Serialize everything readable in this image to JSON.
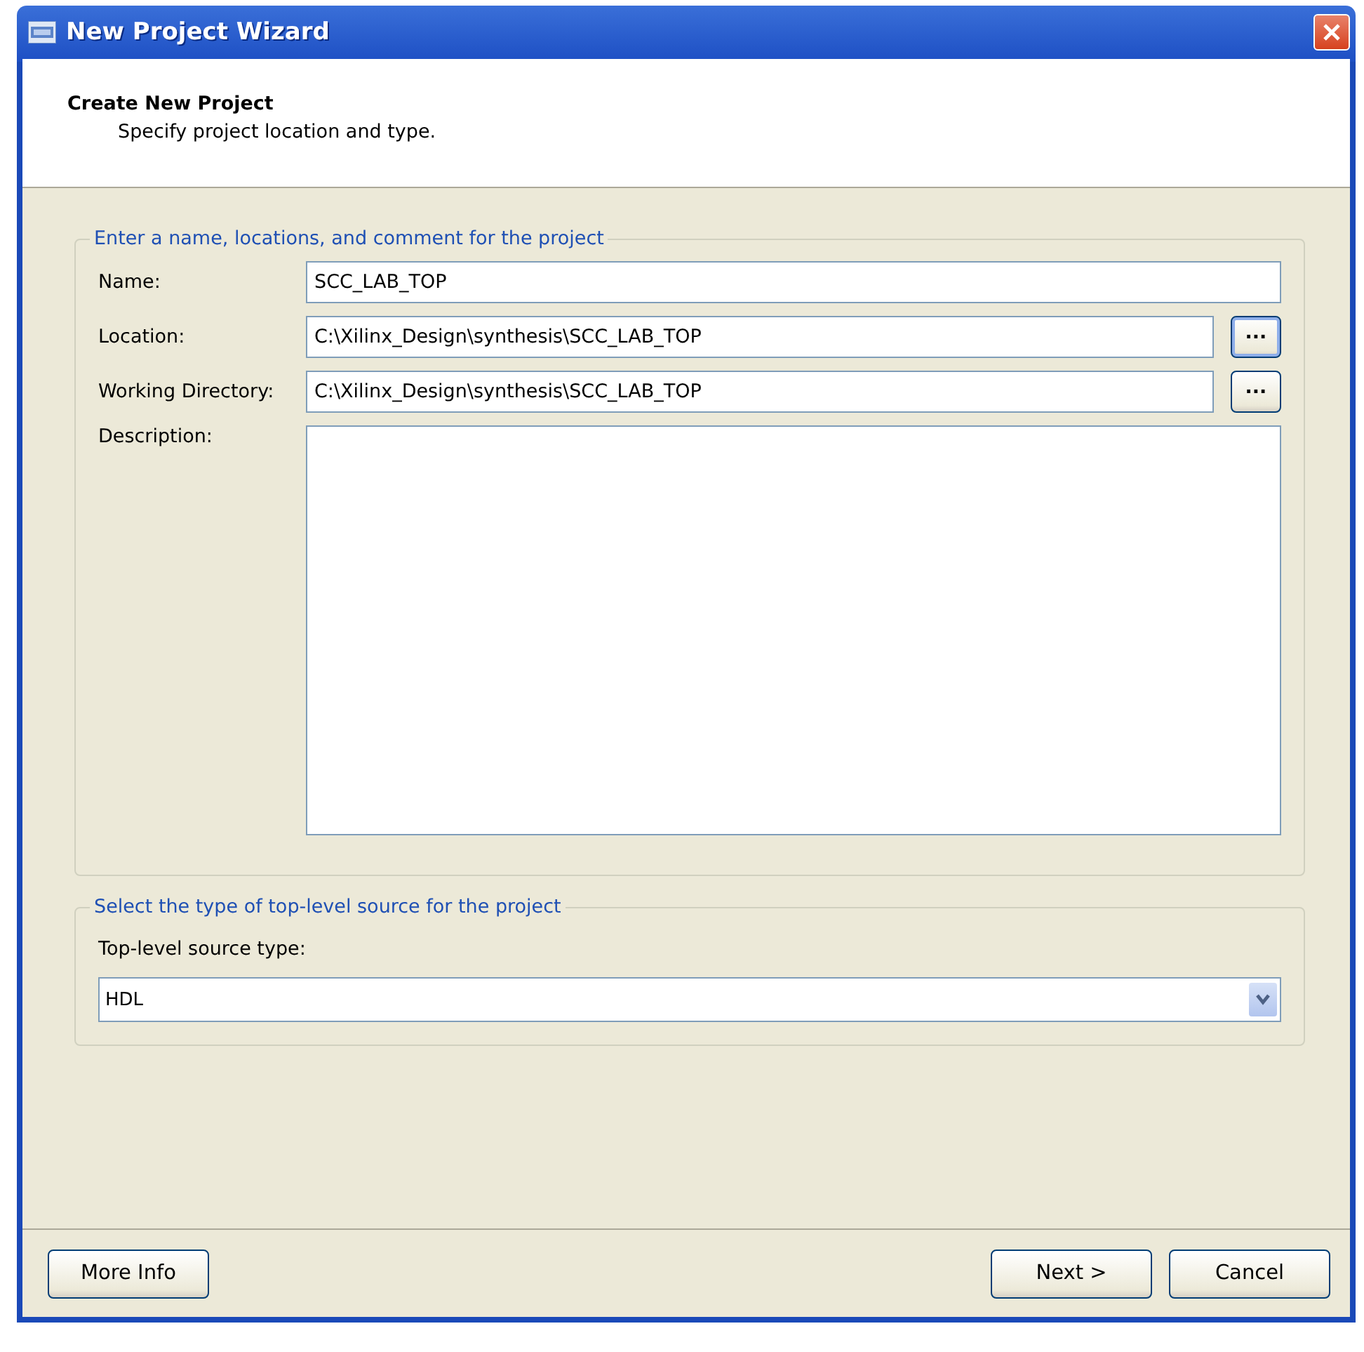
{
  "window": {
    "title": "New Project Wizard"
  },
  "header": {
    "title": "Create New Project",
    "subtitle": "Specify project location and type."
  },
  "project_group": {
    "legend": "Enter a name, locations, and comment for the project",
    "fields": [
      {
        "kind": "text",
        "label": "Name:",
        "value": "SCC_LAB_TOP"
      },
      {
        "kind": "browse",
        "label": "Location:",
        "value": "C:\\Xilinx_Design\\synthesis\\SCC_LAB_TOP",
        "browse_label": "...",
        "focused": true
      },
      {
        "kind": "browse",
        "label": "Working Directory:",
        "value": "C:\\Xilinx_Design\\synthesis\\SCC_LAB_TOP",
        "browse_label": "...",
        "focused": false
      },
      {
        "kind": "textarea",
        "label": "Description:"
      }
    ]
  },
  "source_group": {
    "legend": "Select the type of top-level source for the project",
    "label": "Top-level source type:",
    "value": "HDL"
  },
  "buttons": {
    "left": [
      "More Info"
    ],
    "right": [
      "Next >",
      "Cancel"
    ]
  }
}
